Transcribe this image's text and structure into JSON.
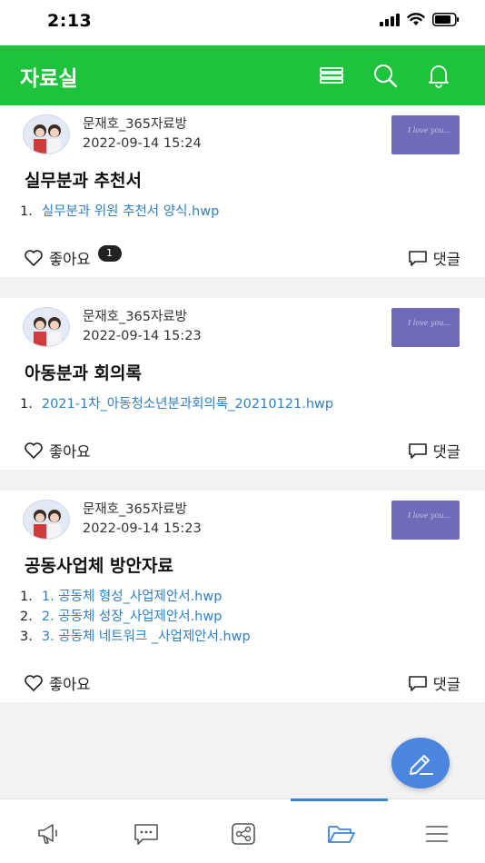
{
  "status": {
    "time": "2:13"
  },
  "header": {
    "title": "자료실",
    "icons": [
      "list-icon",
      "search-icon",
      "bell-icon"
    ]
  },
  "posts": [
    {
      "author": "문재호_365자료방",
      "date": "2022-09-14 15:24",
      "title": "실무분과 추천서",
      "files": [
        {
          "num": "1.",
          "name": "실무분과 위원 추천서 양식.hwp"
        }
      ],
      "like_label": "좋아요",
      "like_count": "1",
      "comment_label": "댓글"
    },
    {
      "author": "문재호_365자료방",
      "date": "2022-09-14 15:23",
      "title": "아동분과 회의록",
      "files": [
        {
          "num": "1.",
          "name": "2021-1차_아동청소년분과회의록_20210121.hwp"
        }
      ],
      "like_label": "좋아요",
      "comment_label": "댓글"
    },
    {
      "author": "문재호_365자료방",
      "date": "2022-09-14 15:23",
      "title": "공동사업체 방안자료",
      "files": [
        {
          "num": "1.",
          "name": "1. 공동체 형성_사업제안서.hwp"
        },
        {
          "num": "2.",
          "name": "2. 공동체 성장_사업제안서.hwp"
        },
        {
          "num": "3.",
          "name": "3. 공동체 네트워크 _사업제안서.hwp"
        }
      ],
      "like_label": "좋아요",
      "comment_label": "댓글"
    }
  ],
  "fab": {
    "icon": "pencil-icon"
  },
  "tabbar": {
    "tabs": [
      "megaphone-icon",
      "chat-icon",
      "share-icon",
      "folder-icon",
      "menu-icon"
    ],
    "active": "folder-icon"
  },
  "colors": {
    "brand_green": "#1ec33c",
    "link_blue": "#2f7fc3",
    "fab_blue": "#4a86e0",
    "thumb_purple": "#6f6bb8"
  }
}
